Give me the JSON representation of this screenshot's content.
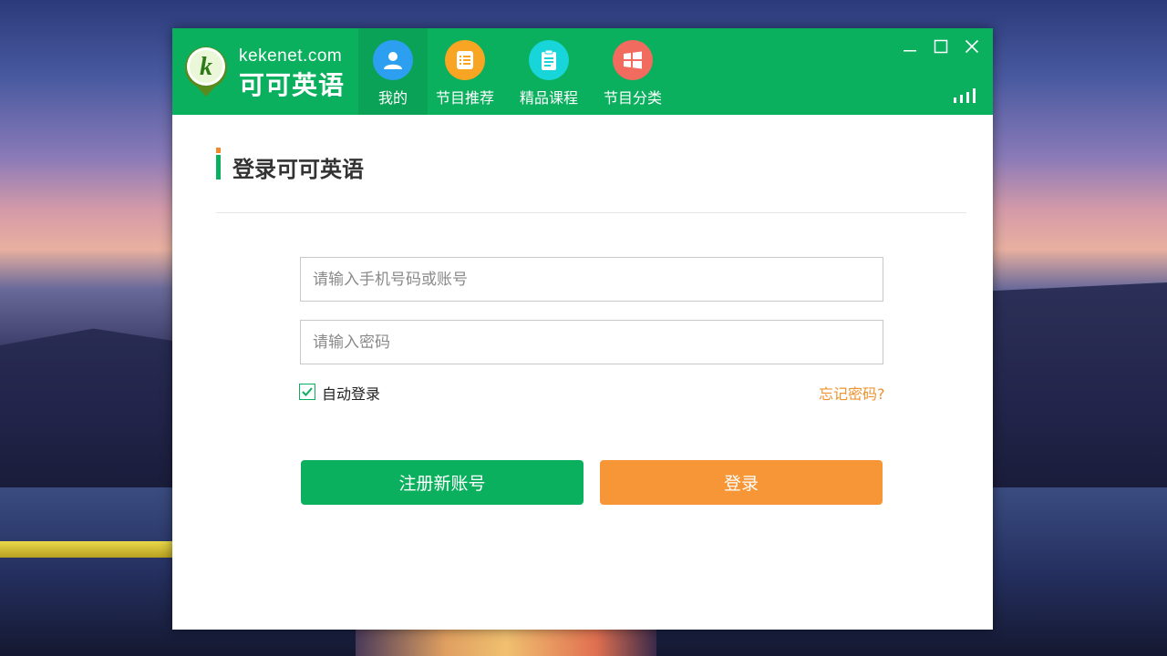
{
  "app": {
    "logo_text_en": "kekenet.com",
    "logo_text_cn": "可可英语",
    "logo_letter": "k"
  },
  "nav": {
    "tabs": [
      {
        "label": "我的",
        "icon": "user-icon",
        "color": "#2d9ff0",
        "active": true
      },
      {
        "label": "节目推荐",
        "icon": "document-list-icon",
        "color": "#f7a522",
        "active": false
      },
      {
        "label": "精品课程",
        "icon": "clipboard-icon",
        "color": "#17d5d8",
        "active": false
      },
      {
        "label": "节目分类",
        "icon": "windows-grid-icon",
        "color": "#f26b5f",
        "active": false
      }
    ]
  },
  "window_controls": [
    "minimize-icon",
    "maximize-icon",
    "close-icon"
  ],
  "login": {
    "heading": "登录可可英语",
    "account_placeholder": "请输入手机号码或账号",
    "password_placeholder": "请输入密码",
    "auto_login_label": "自动登录",
    "auto_login_checked": true,
    "forgot_label": "忘记密码?",
    "register_label": "注册新账号",
    "login_label": "登录"
  },
  "colors": {
    "brand_green": "#0bb05e",
    "accent_orange": "#f79636",
    "forgot_orange": "#f0922e"
  }
}
